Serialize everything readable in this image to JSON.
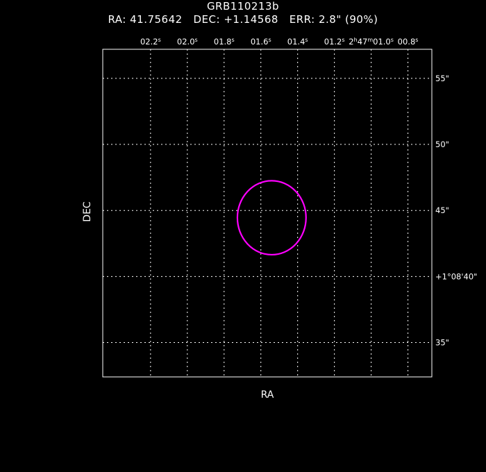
{
  "header": {
    "title": "GRB110213b",
    "ra_label": "RA:",
    "ra_value": "41.75642",
    "dec_label": "DEC:",
    "dec_value": "+1.14568",
    "err_label": "ERR:",
    "err_value": "2.8\" (90%)"
  },
  "chart_data": {
    "type": "scatter",
    "title": "GRB110213b",
    "subtitle": "RA: 41.75642   DEC: +1.14568   ERR: 2.8\" (90%)",
    "xlabel": "RA",
    "ylabel": "DEC",
    "x_tick_labels": [
      {
        "ra_s": 2.2,
        "text": "02.2",
        "sup": "s"
      },
      {
        "ra_s": 2.0,
        "text": "02.0",
        "sup": "s"
      },
      {
        "ra_s": 1.8,
        "text": "01.8",
        "sup": "s"
      },
      {
        "ra_s": 1.6,
        "text": "01.6",
        "sup": "s"
      },
      {
        "ra_s": 1.4,
        "text": "01.4",
        "sup": "s"
      },
      {
        "ra_s": 1.2,
        "text": "01.2",
        "sup": "s"
      },
      {
        "ra_s": 1.0,
        "text": "2h47m01.0",
        "sup": "s"
      },
      {
        "ra_s": 0.8,
        "text": "00.8",
        "sup": "s"
      }
    ],
    "y_tick_labels": [
      {
        "dec_arcsec": 55,
        "text": "55\""
      },
      {
        "dec_arcsec": 50,
        "text": "50\""
      },
      {
        "dec_arcsec": 45,
        "text": "45\""
      },
      {
        "dec_arcsec": 40,
        "text": "+1°08'40\""
      },
      {
        "dec_arcsec": 35,
        "text": "35\""
      }
    ],
    "xlim_ra_s": [
      2.46,
      0.67
    ],
    "ylim_dec_arcsec": [
      32.4,
      57.2
    ],
    "grid": true,
    "error_circle": {
      "ra_s": 1.541,
      "dec_arcsec": 44.45,
      "radius_arcsec": 2.8,
      "color": "#ff00ff"
    },
    "colors": {
      "background": "#000000",
      "foreground": "#ffffff",
      "circle": "#ff00ff"
    }
  }
}
